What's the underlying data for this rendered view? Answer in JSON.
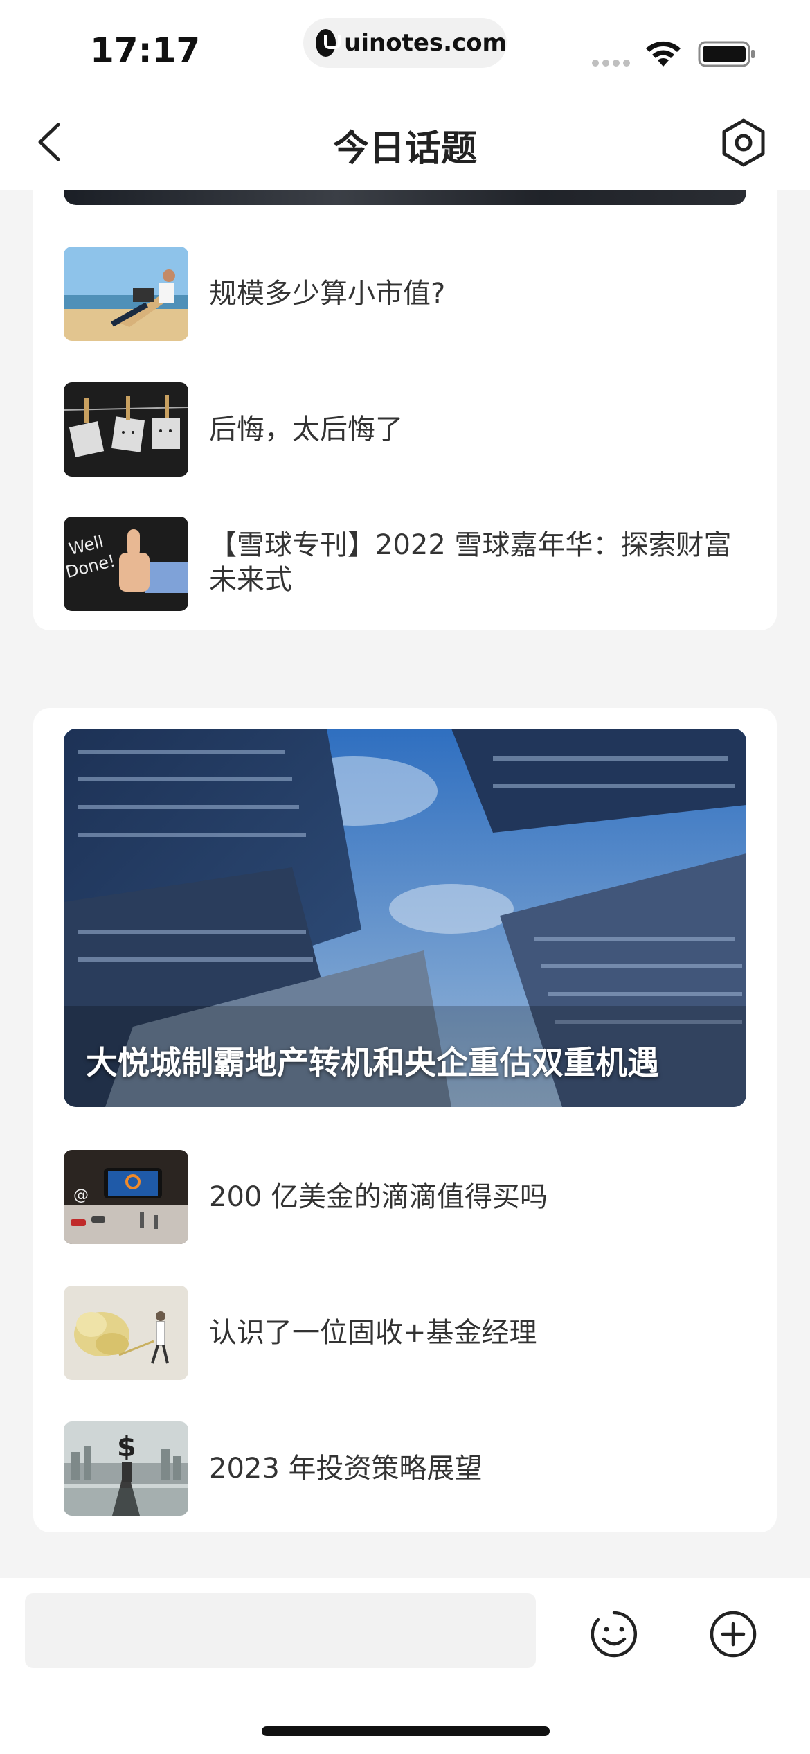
{
  "status_bar": {
    "time": "17:17",
    "url": "uinotes.com"
  },
  "nav": {
    "title": "今日话题"
  },
  "card1": {
    "items": [
      {
        "text": "规模多少算小市值?",
        "thumb_icon": "beach-laptop-image"
      },
      {
        "text": "后悔，太后悔了",
        "thumb_icon": "sad-faces-image"
      },
      {
        "text": "【雪球专刊】2022 雪球嘉年华：探索财富未来式",
        "thumb_icon": "well-done-thumbs-up-image",
        "thumb_text": "Well Done!"
      }
    ]
  },
  "card2": {
    "hero_caption": "大悦城制霸地产转机和央企重估双重机遇",
    "items": [
      {
        "text": "200 亿美金的滴滴值得买吗",
        "thumb_icon": "didi-phone-image"
      },
      {
        "text": "认识了一位固收+基金经理",
        "thumb_icon": "money-cloud-image"
      },
      {
        "text": "2023 年投资策略展望",
        "thumb_icon": "dollar-road-image"
      }
    ]
  },
  "bottom_bar": {
    "input_value": ""
  },
  "colors": {
    "background": "#f4f4f4",
    "card": "#ffffff",
    "text": "#333333",
    "title": "#222222"
  }
}
